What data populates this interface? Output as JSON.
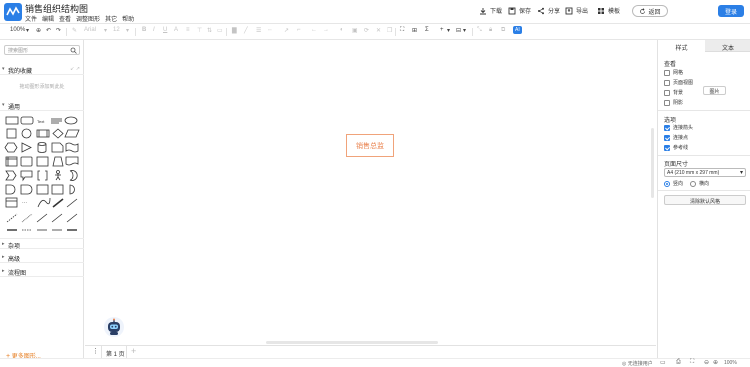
{
  "app": {
    "title": "销售组织结构图"
  },
  "menu": [
    "文件",
    "编辑",
    "查看",
    "调整图形",
    "其它",
    "帮助"
  ],
  "header_actions": {
    "download": "下载",
    "save": "保存",
    "share": "分享",
    "export": "导出",
    "template": "模板",
    "back": "返回",
    "login": "登录"
  },
  "toolbar": {
    "zoom": "100%",
    "font": "Arial",
    "font_size": "12",
    "sigma": "Σ",
    "ai": "AI"
  },
  "sidebar": {
    "search_placeholder": "搜索图形",
    "favorites_title": "我的收藏",
    "favorites_hint": "拖动图形添加到此处",
    "general_title": "通用",
    "sections": [
      "杂项",
      "高级",
      "流程图"
    ],
    "more_shapes": "更多图形..."
  },
  "canvas": {
    "node_label": "销售总监"
  },
  "pages": {
    "current": "第 1 页"
  },
  "statusbar": {
    "text": "无连接用户",
    "zoom": "100%"
  },
  "right_panel": {
    "tabs": [
      "样式",
      "文本"
    ],
    "view_title": "查看",
    "view_options": [
      {
        "label": "网格",
        "checked": false
      },
      {
        "label": "页面视图",
        "checked": false
      },
      {
        "label": "背景",
        "checked": false
      },
      {
        "label": "阴影",
        "checked": false
      }
    ],
    "image_button": "图片",
    "options_title": "选项",
    "options": [
      {
        "label": "连接箭头",
        "checked": true
      },
      {
        "label": "连接点",
        "checked": true
      },
      {
        "label": "参考线",
        "checked": true
      }
    ],
    "paper_title": "页面尺寸",
    "paper_size": "A4 (210 mm x 297 mm)",
    "orientation": {
      "portrait": "竖向",
      "landscape": "横向",
      "selected": "portrait"
    },
    "reset_button": "清除默认风格"
  },
  "colors": {
    "accent": "#2b7fe6",
    "node_border": "#f0a37a",
    "node_text": "#e9824e",
    "more_shapes": "#e67e22"
  }
}
